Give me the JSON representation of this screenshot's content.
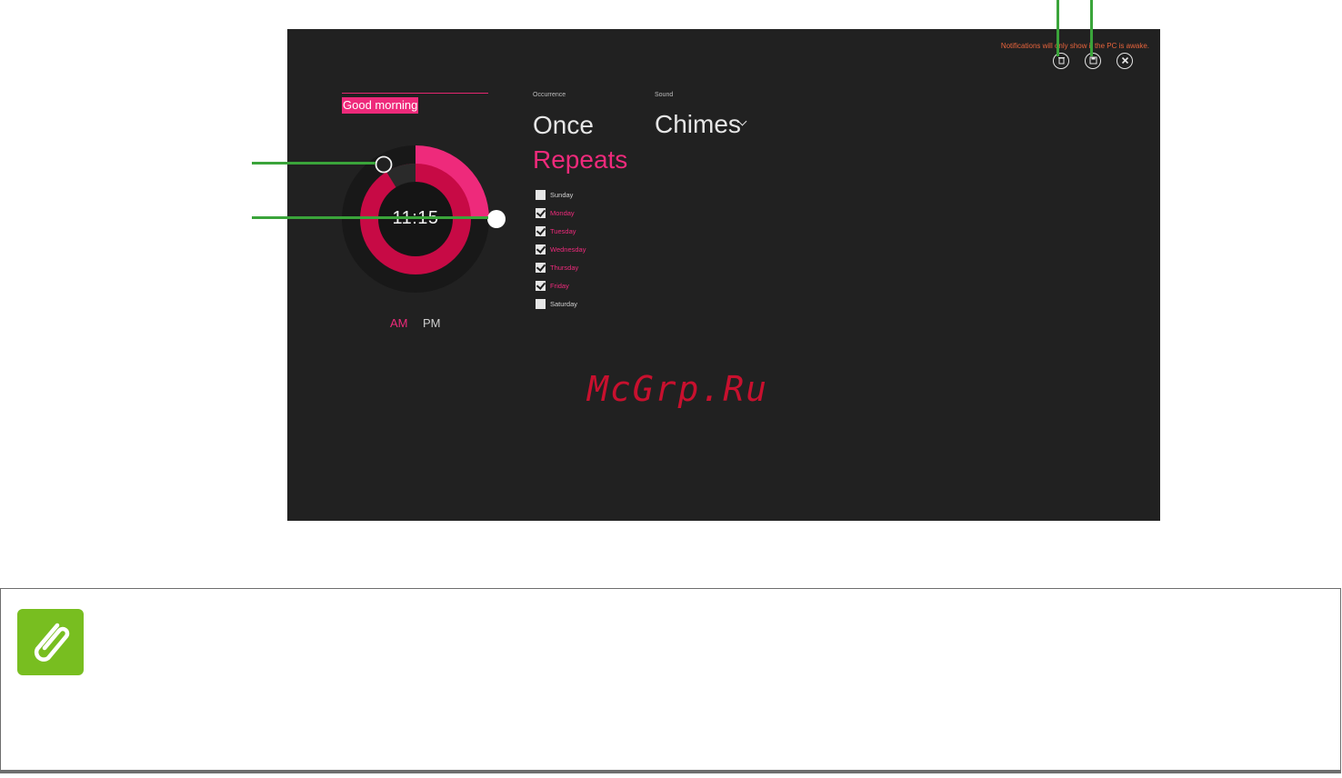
{
  "notification": "Notifications will only show if the PC is awake.",
  "toolbar": {
    "delete_icon": "trash-icon",
    "save_icon": "save-icon",
    "close_icon": "close-icon"
  },
  "alarm_name": "Good morning",
  "clock": {
    "time": "11:15",
    "am_label": "AM",
    "pm_label": "PM",
    "selected_period": "AM"
  },
  "occurrence": {
    "label": "Occurrence",
    "once": "Once",
    "repeats": "Repeats",
    "selected": "Repeats",
    "days": [
      {
        "label": "Sunday",
        "checked": false
      },
      {
        "label": "Monday",
        "checked": true
      },
      {
        "label": "Tuesday",
        "checked": true
      },
      {
        "label": "Wednesday",
        "checked": true
      },
      {
        "label": "Thursday",
        "checked": true
      },
      {
        "label": "Friday",
        "checked": true
      },
      {
        "label": "Saturday",
        "checked": false
      }
    ]
  },
  "sound": {
    "label": "Sound",
    "value": "Chimes"
  },
  "watermark": "McGrp.Ru",
  "colors": {
    "accent": "#ee2a7b",
    "background": "#212121",
    "callout": "#3aa43a",
    "note_icon": "#78be20"
  },
  "note_icon": "paperclip-icon"
}
